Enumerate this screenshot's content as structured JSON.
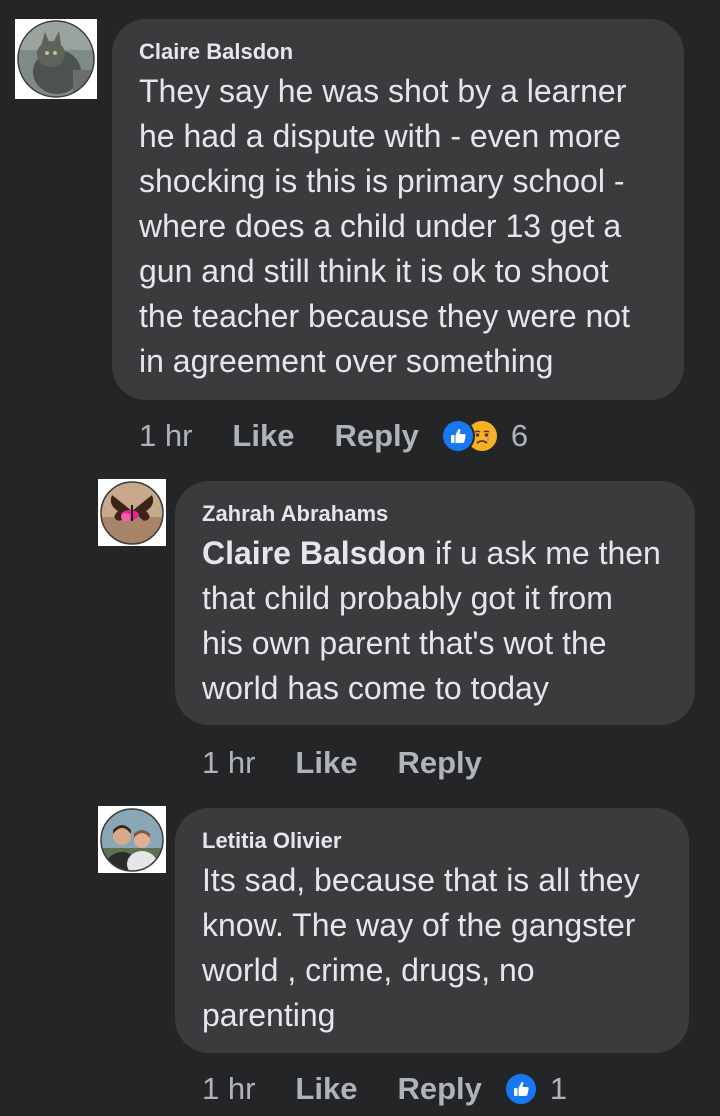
{
  "comments": [
    {
      "author": "Claire Balsdon",
      "text": "They say he was shot by a learner\nhe had a dispute with - even more\nshocking is this is primary school -\nwhere does a child under 13 get a\ngun and still think it is ok to shoot\nthe teacher because they were not\nin agreement over something",
      "time": "1 hr",
      "like_label": "Like",
      "reply_label": "Reply",
      "reactions": [
        "like-icon",
        "sad-icon"
      ],
      "reaction_count": "6"
    },
    {
      "author": "Zahrah Abrahams",
      "mention": "Claire Balsdon",
      "text": " if u ask me then\nthat child probably got it from\nhis own parent that's wot the\nworld has come to today",
      "time": "1 hr",
      "like_label": "Like",
      "reply_label": "Reply"
    },
    {
      "author": "Letitia Olivier",
      "text": "Its sad, because that is all they\nknow. The way of the gangster\nworld , crime, drugs, no\nparenting",
      "time": "1 hr",
      "like_label": "Like",
      "reply_label": "Reply",
      "reactions": [
        "like-icon"
      ],
      "reaction_count": "1"
    }
  ],
  "colors": {
    "background": "#242526",
    "bubble": "#3a3b3c",
    "text": "#e4e6eb",
    "meta": "#b0b3b8",
    "like_blue": "#1877f2",
    "sad_yellow": "#f7b125"
  }
}
